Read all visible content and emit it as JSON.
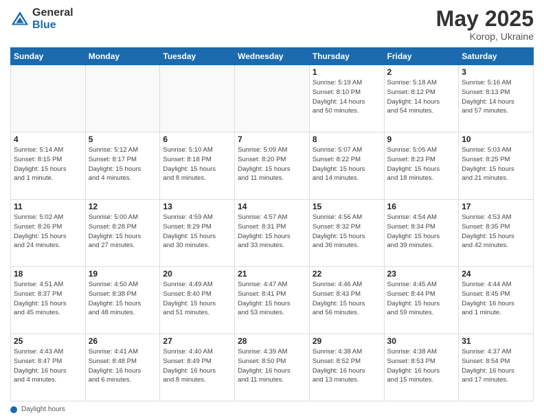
{
  "header": {
    "logo_general": "General",
    "logo_blue": "Blue",
    "title": "May 2025",
    "location": "Korop, Ukraine"
  },
  "days_of_week": [
    "Sunday",
    "Monday",
    "Tuesday",
    "Wednesday",
    "Thursday",
    "Friday",
    "Saturday"
  ],
  "footer": {
    "label": "Daylight hours"
  },
  "weeks": [
    [
      {
        "day": "",
        "info": ""
      },
      {
        "day": "",
        "info": ""
      },
      {
        "day": "",
        "info": ""
      },
      {
        "day": "",
        "info": ""
      },
      {
        "day": "1",
        "info": "Sunrise: 5:19 AM\nSunset: 8:10 PM\nDaylight: 14 hours\nand 50 minutes."
      },
      {
        "day": "2",
        "info": "Sunrise: 5:18 AM\nSunset: 8:12 PM\nDaylight: 14 hours\nand 54 minutes."
      },
      {
        "day": "3",
        "info": "Sunrise: 5:16 AM\nSunset: 8:13 PM\nDaylight: 14 hours\nand 57 minutes."
      }
    ],
    [
      {
        "day": "4",
        "info": "Sunrise: 5:14 AM\nSunset: 8:15 PM\nDaylight: 15 hours\nand 1 minute."
      },
      {
        "day": "5",
        "info": "Sunrise: 5:12 AM\nSunset: 8:17 PM\nDaylight: 15 hours\nand 4 minutes."
      },
      {
        "day": "6",
        "info": "Sunrise: 5:10 AM\nSunset: 8:18 PM\nDaylight: 15 hours\nand 8 minutes."
      },
      {
        "day": "7",
        "info": "Sunrise: 5:09 AM\nSunset: 8:20 PM\nDaylight: 15 hours\nand 11 minutes."
      },
      {
        "day": "8",
        "info": "Sunrise: 5:07 AM\nSunset: 8:22 PM\nDaylight: 15 hours\nand 14 minutes."
      },
      {
        "day": "9",
        "info": "Sunrise: 5:05 AM\nSunset: 8:23 PM\nDaylight: 15 hours\nand 18 minutes."
      },
      {
        "day": "10",
        "info": "Sunrise: 5:03 AM\nSunset: 8:25 PM\nDaylight: 15 hours\nand 21 minutes."
      }
    ],
    [
      {
        "day": "11",
        "info": "Sunrise: 5:02 AM\nSunset: 8:26 PM\nDaylight: 15 hours\nand 24 minutes."
      },
      {
        "day": "12",
        "info": "Sunrise: 5:00 AM\nSunset: 8:28 PM\nDaylight: 15 hours\nand 27 minutes."
      },
      {
        "day": "13",
        "info": "Sunrise: 4:59 AM\nSunset: 8:29 PM\nDaylight: 15 hours\nand 30 minutes."
      },
      {
        "day": "14",
        "info": "Sunrise: 4:57 AM\nSunset: 8:31 PM\nDaylight: 15 hours\nand 33 minutes."
      },
      {
        "day": "15",
        "info": "Sunrise: 4:56 AM\nSunset: 8:32 PM\nDaylight: 15 hours\nand 36 minutes."
      },
      {
        "day": "16",
        "info": "Sunrise: 4:54 AM\nSunset: 8:34 PM\nDaylight: 15 hours\nand 39 minutes."
      },
      {
        "day": "17",
        "info": "Sunrise: 4:53 AM\nSunset: 8:35 PM\nDaylight: 15 hours\nand 42 minutes."
      }
    ],
    [
      {
        "day": "18",
        "info": "Sunrise: 4:51 AM\nSunset: 8:37 PM\nDaylight: 15 hours\nand 45 minutes."
      },
      {
        "day": "19",
        "info": "Sunrise: 4:50 AM\nSunset: 8:38 PM\nDaylight: 15 hours\nand 48 minutes."
      },
      {
        "day": "20",
        "info": "Sunrise: 4:49 AM\nSunset: 8:40 PM\nDaylight: 15 hours\nand 51 minutes."
      },
      {
        "day": "21",
        "info": "Sunrise: 4:47 AM\nSunset: 8:41 PM\nDaylight: 15 hours\nand 53 minutes."
      },
      {
        "day": "22",
        "info": "Sunrise: 4:46 AM\nSunset: 8:43 PM\nDaylight: 15 hours\nand 56 minutes."
      },
      {
        "day": "23",
        "info": "Sunrise: 4:45 AM\nSunset: 8:44 PM\nDaylight: 15 hours\nand 59 minutes."
      },
      {
        "day": "24",
        "info": "Sunrise: 4:44 AM\nSunset: 8:45 PM\nDaylight: 16 hours\nand 1 minute."
      }
    ],
    [
      {
        "day": "25",
        "info": "Sunrise: 4:43 AM\nSunset: 8:47 PM\nDaylight: 16 hours\nand 4 minutes."
      },
      {
        "day": "26",
        "info": "Sunrise: 4:41 AM\nSunset: 8:48 PM\nDaylight: 16 hours\nand 6 minutes."
      },
      {
        "day": "27",
        "info": "Sunrise: 4:40 AM\nSunset: 8:49 PM\nDaylight: 16 hours\nand 8 minutes."
      },
      {
        "day": "28",
        "info": "Sunrise: 4:39 AM\nSunset: 8:50 PM\nDaylight: 16 hours\nand 11 minutes."
      },
      {
        "day": "29",
        "info": "Sunrise: 4:38 AM\nSunset: 8:52 PM\nDaylight: 16 hours\nand 13 minutes."
      },
      {
        "day": "30",
        "info": "Sunrise: 4:38 AM\nSunset: 8:53 PM\nDaylight: 16 hours\nand 15 minutes."
      },
      {
        "day": "31",
        "info": "Sunrise: 4:37 AM\nSunset: 8:54 PM\nDaylight: 16 hours\nand 17 minutes."
      }
    ]
  ]
}
